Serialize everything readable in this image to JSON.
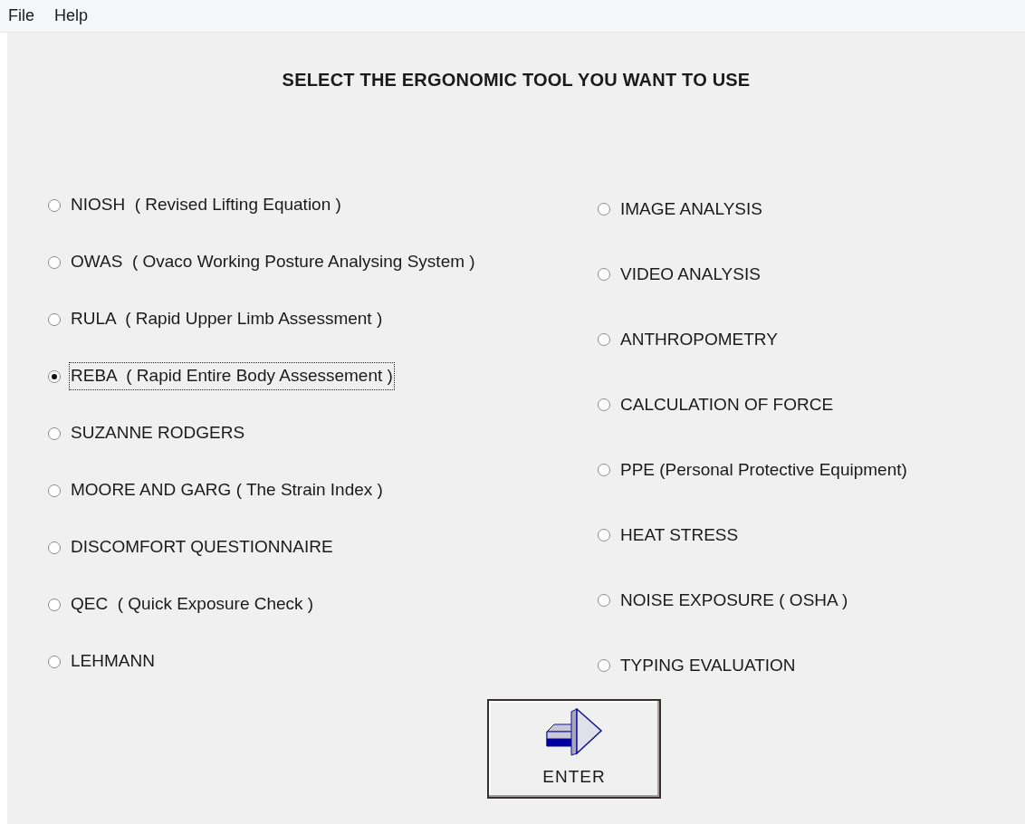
{
  "menu": [
    "File",
    "Help"
  ],
  "title": "SELECT THE ERGONOMIC TOOL YOU WANT TO USE",
  "left_options": [
    {
      "label": "NIOSH  ( Revised Lifting Equation )",
      "selected": false,
      "focused": false
    },
    {
      "label": "OWAS  ( Ovaco Working Posture Analysing System )",
      "selected": false,
      "focused": false
    },
    {
      "label": "RULA  ( Rapid Upper Limb Assessment )",
      "selected": false,
      "focused": false
    },
    {
      "label": "REBA  ( Rapid Entire Body Assessement )",
      "selected": true,
      "focused": true
    },
    {
      "label": "SUZANNE RODGERS",
      "selected": false,
      "focused": false
    },
    {
      "label": "MOORE AND GARG ( The Strain Index )",
      "selected": false,
      "focused": false
    },
    {
      "label": "DISCOMFORT QUESTIONNAIRE",
      "selected": false,
      "focused": false
    },
    {
      "label": "QEC  ( Quick Exposure Check )",
      "selected": false,
      "focused": false
    },
    {
      "label": "LEHMANN",
      "selected": false,
      "focused": false
    }
  ],
  "right_options": [
    {
      "label": "IMAGE ANALYSIS",
      "selected": false,
      "focused": false
    },
    {
      "label": "VIDEO ANALYSIS",
      "selected": false,
      "focused": false
    },
    {
      "label": "ANTHROPOMETRY",
      "selected": false,
      "focused": false
    },
    {
      "label": "CALCULATION OF FORCE",
      "selected": false,
      "focused": false
    },
    {
      "label": "PPE (Personal Protective Equipment)",
      "selected": false,
      "focused": false
    },
    {
      "label": "HEAT STRESS",
      "selected": false,
      "focused": false
    },
    {
      "label": "NOISE EXPOSURE ( OSHA )",
      "selected": false,
      "focused": false
    },
    {
      "label": "TYPING EVALUATION",
      "selected": false,
      "focused": false
    }
  ],
  "enter_button": {
    "label": "ENTER"
  }
}
